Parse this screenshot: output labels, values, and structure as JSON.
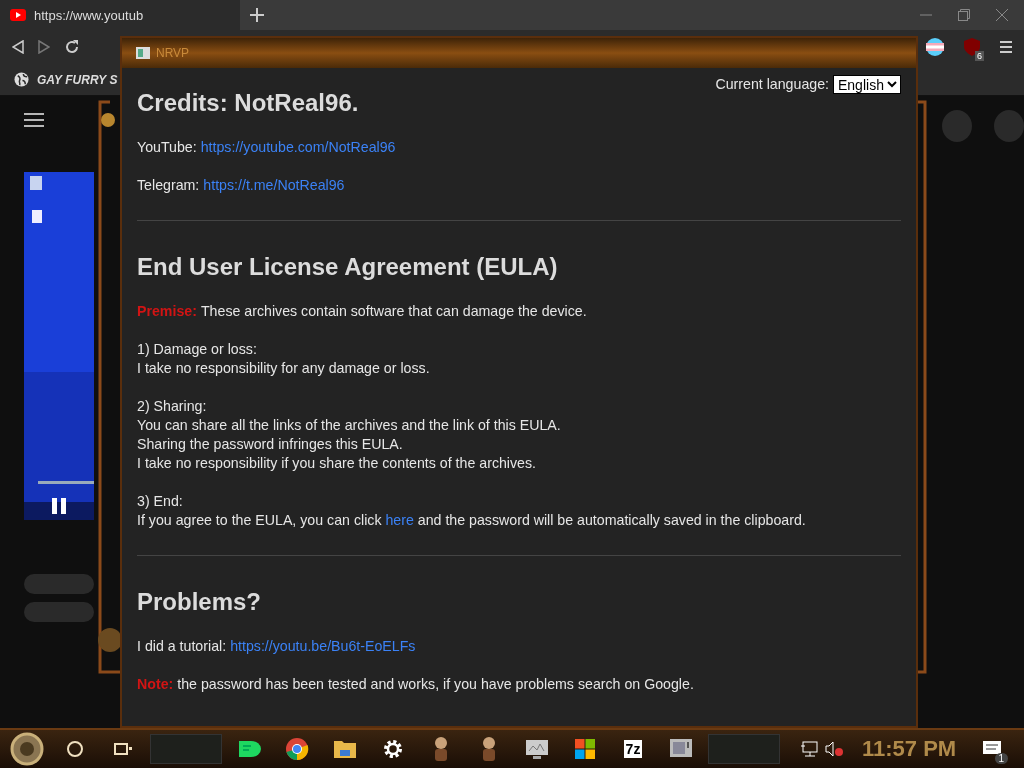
{
  "browser": {
    "tab": {
      "title": "https://www.youtub"
    },
    "bookmarks": [
      {
        "label": "GAY FURRY S"
      }
    ],
    "extensions": [
      {
        "kind": "flag"
      },
      {
        "kind": "blocker",
        "badge": "6"
      }
    ]
  },
  "app_window": {
    "title": "NRVP",
    "language": {
      "label": "Current language:",
      "value": "English"
    },
    "sections": [
      {
        "heading": "Credits: NotReal96.",
        "blocks": [
          {
            "kind": "link_line",
            "label": "YouTube:",
            "url": "https://youtube.com/NotReal96"
          },
          {
            "kind": "link_line",
            "label": "Telegram:",
            "url": "https://t.me/NotReal96"
          }
        ]
      },
      {
        "heading": "End User License Agreement (EULA)",
        "blocks": [
          {
            "kind": "notice",
            "label": "Premise:",
            "text": "These archives contain software that can damage the device."
          },
          {
            "kind": "lines",
            "lines": [
              "1) Damage or loss:",
              "I take no responsibility for any damage or loss."
            ]
          },
          {
            "kind": "lines",
            "lines": [
              "2) Sharing:",
              "You can share all the links of the archives and the link of this EULA.",
              "Sharing the password infringes this EULA.",
              "I take no responsibility if you share the contents of the archives."
            ]
          },
          {
            "kind": "sentence",
            "title": "3) End:",
            "before": "If you agree to the EULA, you can click ",
            "link": "here",
            "after": " and the password will be automatically saved in the clipboard."
          }
        ]
      },
      {
        "heading": "Problems?",
        "blocks": [
          {
            "kind": "link_line",
            "label": "I did a tutorial:",
            "url": "https://youtu.be/Bu6t-EoELFs"
          },
          {
            "kind": "notice",
            "label": "Note:",
            "text": "the password has been tested and works, if you have problems search on Google."
          }
        ]
      }
    ]
  },
  "taskbar": {
    "apps": [
      {
        "kind": "chat"
      },
      {
        "kind": "chrome"
      },
      {
        "kind": "folder"
      },
      {
        "kind": "settings"
      },
      {
        "kind": "figure"
      },
      {
        "kind": "figure"
      },
      {
        "kind": "monitor"
      },
      {
        "kind": "store"
      },
      {
        "kind": "archive",
        "label": "7z"
      },
      {
        "kind": "screen"
      }
    ],
    "clock": "11:57 PM",
    "notifications": "1"
  }
}
